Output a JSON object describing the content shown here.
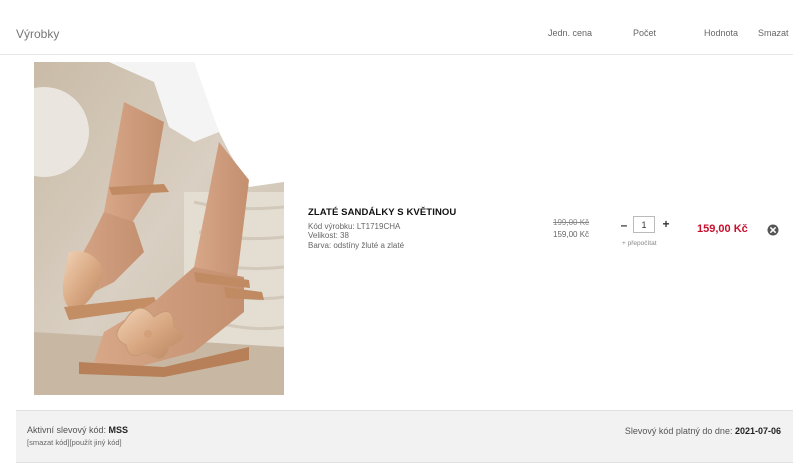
{
  "header": {
    "title": "Výrobky",
    "col_unit_price": "Jedn. cena",
    "col_quantity": "Počet",
    "col_value": "Hodnota",
    "col_delete": "Smazat"
  },
  "item": {
    "image_alt": "Zlaté sandálky s květinou",
    "name": "ZLATÉ SANDÁLKY S KVĚTINOU",
    "code": "Kód výrobku: LT1719CHA",
    "size": "Velikost: 38",
    "color": "Barva: odstíny žluté a zlaté",
    "old_price": "199,00 Kč",
    "unit_price": "159,00 Kč",
    "minus_label": "–",
    "quantity": "1",
    "plus_label": "+",
    "recalc_label": "+ přepočítat",
    "total": "159,00 Kč",
    "delete_icon": "close-circle-icon"
  },
  "discount": {
    "active_label": "Aktivní slevový kód: ",
    "active_code": "MSS",
    "delete_link": "[smazat kód]",
    "use_other_link": "[použít jiný kód]",
    "valid_label": "Slevový kód platný do dne: ",
    "valid_date": "2021-07-06"
  },
  "colors": {
    "accent_price": "#c8102e",
    "footer_bg": "#f2f2f2"
  }
}
